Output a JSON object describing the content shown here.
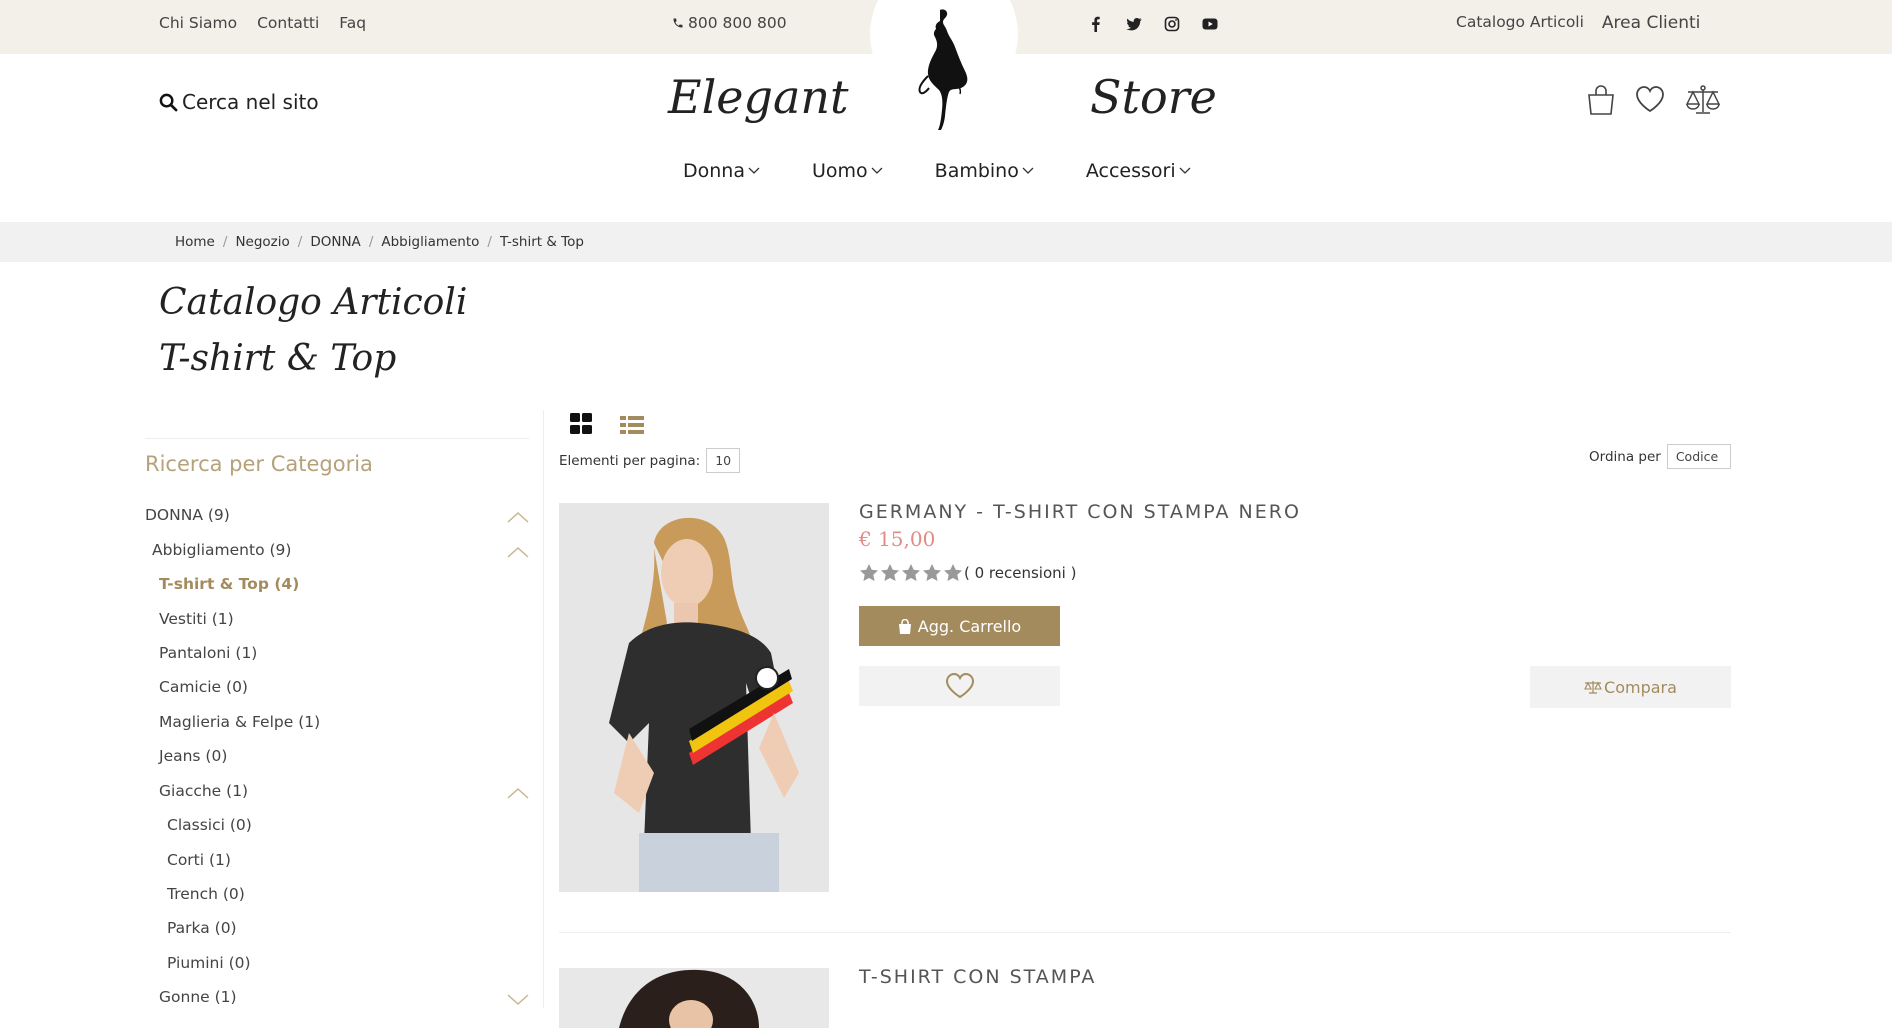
{
  "topbar": {
    "links": [
      "Chi Siamo",
      "Contatti",
      "Faq"
    ],
    "phone": "800 800 800",
    "social_icons": [
      "facebook-icon",
      "twitter-icon",
      "instagram-icon",
      "youtube-icon"
    ],
    "catalog_link": "Catalogo Articoli",
    "area_link": "Area Clienti"
  },
  "header": {
    "brand_left": "Elegant",
    "brand_right": "Store",
    "search_label": "Cerca nel sito",
    "icons": [
      "shopping-bag-icon",
      "heart-icon",
      "scale-icon"
    ]
  },
  "nav": {
    "items": [
      "Donna",
      "Uomo",
      "Bambino",
      "Accessori"
    ]
  },
  "breadcrumb": [
    "Home",
    "Negozio",
    "DONNA",
    "Abbigliamento",
    "T-shirt & Top"
  ],
  "page": {
    "title_line1": "Catalogo Articoli",
    "title_line2": "T-shirt & Top"
  },
  "sidebar": {
    "title": "Ricerca per Categoria",
    "categories": [
      {
        "label": "DONNA (9)",
        "level": 0,
        "expanded": true
      },
      {
        "label": "Abbigliamento (9)",
        "level": 1,
        "expanded": true
      },
      {
        "label": "T-shirt & Top (4)",
        "level": 2,
        "active": true
      },
      {
        "label": "Vestiti (1)",
        "level": 2
      },
      {
        "label": "Pantaloni (1)",
        "level": 2
      },
      {
        "label": "Camicie (0)",
        "level": 2
      },
      {
        "label": "Maglieria & Felpe (1)",
        "level": 2
      },
      {
        "label": "Jeans (0)",
        "level": 2
      },
      {
        "label": "Giacche (1)",
        "level": 2,
        "expanded": true
      },
      {
        "label": "Classici (0)",
        "level": 3
      },
      {
        "label": "Corti (1)",
        "level": 3
      },
      {
        "label": "Trench (0)",
        "level": 3
      },
      {
        "label": "Parka (0)",
        "level": 3
      },
      {
        "label": "Piumini (0)",
        "level": 3
      },
      {
        "label": "Gonne (1)",
        "level": 2,
        "expanded": false
      }
    ]
  },
  "toolbar": {
    "per_page_label": "Elementi per pagina:",
    "per_page_value": "10",
    "order_label": "Ordina per",
    "order_value": "Codice"
  },
  "products": [
    {
      "title": "GERMANY - T-SHIRT CON STAMPA NERO",
      "price": "€ 15,00",
      "rating": 0,
      "reviews": "( 0 recensioni )",
      "cart_label": "Agg. Carrello",
      "compare_label": "Compara"
    },
    {
      "title": "T-SHIRT CON STAMPA"
    }
  ],
  "colors": {
    "accent": "#a38b5e",
    "topbar_bg": "#f3f0ea",
    "price": "#e08c84",
    "category_title": "#b5a27a"
  }
}
